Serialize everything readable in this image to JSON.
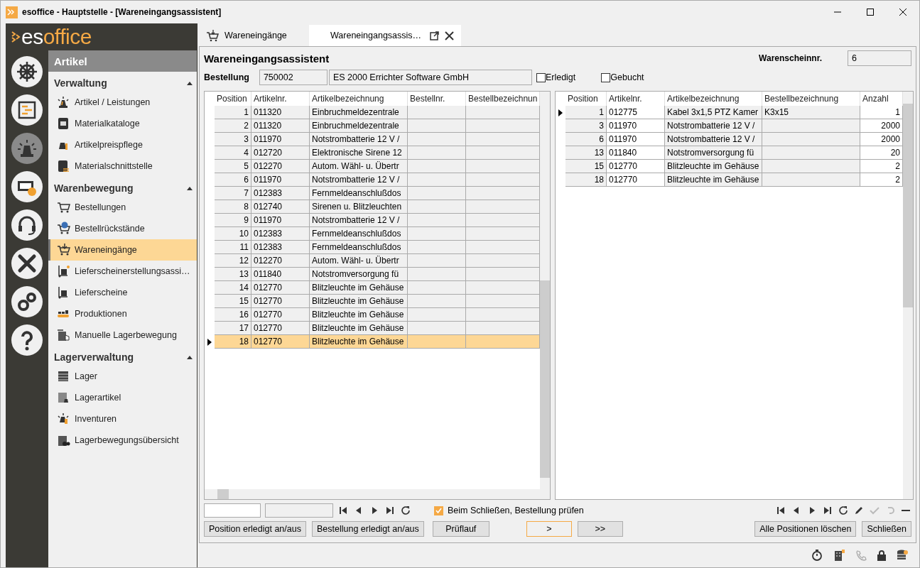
{
  "window": {
    "title": "esoffice - Hauptstelle - [Wareneingangsassistent]"
  },
  "logo": {
    "text_a": "es",
    "text_b": "office"
  },
  "rail": [
    {
      "selected": false
    },
    {
      "selected": false
    },
    {
      "selected": true
    },
    {
      "selected": false
    },
    {
      "selected": false
    },
    {
      "selected": false
    },
    {
      "selected": false
    },
    {
      "selected": false
    }
  ],
  "sidebar": {
    "header": "Artikel",
    "groups": [
      {
        "title": "Verwaltung",
        "expanded": true,
        "items": [
          {
            "label": "Artikel / Leistungen",
            "selected": false
          },
          {
            "label": "Materialkataloge",
            "selected": false
          },
          {
            "label": "Artikelpreispflege",
            "selected": false
          },
          {
            "label": "Materialschnittstelle",
            "selected": false
          }
        ]
      },
      {
        "title": "Warenbewegung",
        "expanded": true,
        "items": [
          {
            "label": "Bestellungen",
            "selected": false
          },
          {
            "label": "Bestellrückstände",
            "selected": false
          },
          {
            "label": "Wareneingänge",
            "selected": true
          },
          {
            "label": "Lieferscheinerstellungsassi…",
            "selected": false
          },
          {
            "label": "Lieferscheine",
            "selected": false
          },
          {
            "label": "Produktionen",
            "selected": false
          },
          {
            "label": "Manuelle Lagerbewegung",
            "selected": false
          }
        ]
      },
      {
        "title": "Lagerverwaltung",
        "expanded": true,
        "items": [
          {
            "label": "Lager",
            "selected": false
          },
          {
            "label": "Lagerartikel",
            "selected": false
          },
          {
            "label": "Inventuren",
            "selected": false
          },
          {
            "label": "Lagerbewegungsübersicht",
            "selected": false
          }
        ]
      }
    ]
  },
  "tabs": [
    {
      "label": "Wareneingänge",
      "selected": false
    },
    {
      "label": "Wareneingangsassis…",
      "selected": true
    }
  ],
  "form": {
    "title": "Wareneingangsassistent",
    "receipt_label": "Warenscheinnr.",
    "receipt_value": "6",
    "order_label": "Bestellung",
    "order_number": "750002",
    "order_supplier": "ES 2000 Errichter Software GmbH",
    "done": {
      "label": "Erledigt",
      "checked": false
    },
    "booked": {
      "label": "Gebucht",
      "checked": false
    }
  },
  "order_table": {
    "columns": [
      "Position",
      "Artikelnr.",
      "Artikelbezeichnung",
      "Bestellnr.",
      "Bestellbezeichnun"
    ],
    "rows": [
      {
        "cells": [
          "1",
          "011320",
          "Einbruchmeldezentrale",
          "",
          ""
        ],
        "selected": false
      },
      {
        "cells": [
          "2",
          "011320",
          "Einbruchmeldezentrale",
          "",
          ""
        ],
        "selected": false
      },
      {
        "cells": [
          "3",
          "011970",
          "Notstrombatterie 12 V /",
          "",
          ""
        ],
        "selected": false
      },
      {
        "cells": [
          "4",
          "012720",
          "Elektronische Sirene 12",
          "",
          ""
        ],
        "selected": false
      },
      {
        "cells": [
          "5",
          "012270",
          "Autom. Wähl- u. Übertr",
          "",
          ""
        ],
        "selected": false
      },
      {
        "cells": [
          "6",
          "011970",
          "Notstrombatterie 12 V /",
          "",
          ""
        ],
        "selected": false
      },
      {
        "cells": [
          "7",
          "012383",
          "Fernmeldeanschlußdos",
          "",
          ""
        ],
        "selected": false
      },
      {
        "cells": [
          "8",
          "012740",
          "Sirenen u. Blitzleuchten",
          "",
          ""
        ],
        "selected": false
      },
      {
        "cells": [
          "9",
          "011970",
          "Notstrombatterie 12 V /",
          "",
          ""
        ],
        "selected": false
      },
      {
        "cells": [
          "10",
          "012383",
          "Fernmeldeanschlußdos",
          "",
          ""
        ],
        "selected": false
      },
      {
        "cells": [
          "11",
          "012383",
          "Fernmeldeanschlußdos",
          "",
          ""
        ],
        "selected": false
      },
      {
        "cells": [
          "12",
          "012270",
          "Autom. Wähl- u. Übertr",
          "",
          ""
        ],
        "selected": false
      },
      {
        "cells": [
          "13",
          "011840",
          "Notstromversorgung fü",
          "",
          ""
        ],
        "selected": false
      },
      {
        "cells": [
          "14",
          "012770",
          "Blitzleuchte im Gehäuse",
          "",
          ""
        ],
        "selected": false
      },
      {
        "cells": [
          "15",
          "012770",
          "Blitzleuchte im Gehäuse",
          "",
          ""
        ],
        "selected": false
      },
      {
        "cells": [
          "16",
          "012770",
          "Blitzleuchte im Gehäuse",
          "",
          ""
        ],
        "selected": false
      },
      {
        "cells": [
          "17",
          "012770",
          "Blitzleuchte im Gehäuse",
          "",
          ""
        ],
        "selected": false
      },
      {
        "cells": [
          "18",
          "012770",
          "Blitzleuchte im Gehäuse",
          "",
          ""
        ],
        "selected": true
      }
    ]
  },
  "receipt_table": {
    "columns": [
      "Position",
      "Artikelnr.",
      "Artikelbezeichnung",
      "Bestellbezeichnung",
      "Anzahl"
    ],
    "rows": [
      {
        "cells": [
          "1",
          "012775",
          "Kabel 3x1,5 PTZ Kamer",
          "K3x15",
          "1"
        ],
        "current": true
      },
      {
        "cells": [
          "3",
          "011970",
          "Notstrombatterie 12 V /",
          "",
          "2000"
        ],
        "current": false
      },
      {
        "cells": [
          "6",
          "011970",
          "Notstrombatterie 12 V /",
          "",
          "2000"
        ],
        "current": false
      },
      {
        "cells": [
          "13",
          "011840",
          "Notstromversorgung fü",
          "",
          "20"
        ],
        "current": false
      },
      {
        "cells": [
          "15",
          "012770",
          "Blitzleuchte im Gehäuse",
          "",
          "2"
        ],
        "current": false
      },
      {
        "cells": [
          "18",
          "012770",
          "Blitzleuchte im Gehäuse",
          "",
          "2"
        ],
        "current": false
      }
    ]
  },
  "check_on_close": {
    "label": "Beim Schließen, Bestellung prüfen",
    "checked": true
  },
  "buttons_left": [
    "Position erledigt an/aus",
    "Bestellung erledigt an/aus",
    "Prüflauf"
  ],
  "step_buttons": [
    {
      "label": ">",
      "focused": true
    },
    {
      "label": ">>",
      "focused": false
    }
  ],
  "buttons_right": [
    "Alle Positionen löschen",
    "Schließen"
  ]
}
